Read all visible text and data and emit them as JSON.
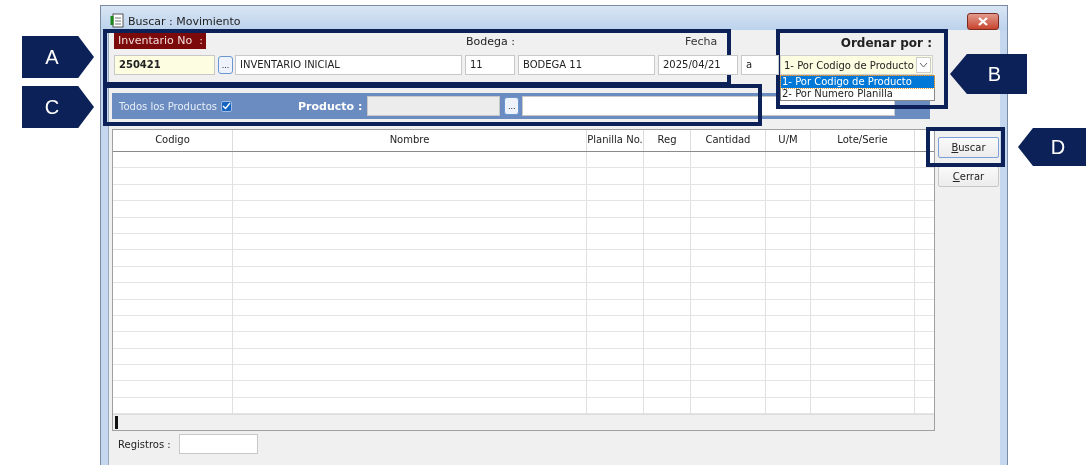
{
  "window": {
    "title": "Buscar : Movimiento"
  },
  "header": {
    "inventario_label": "Inventario No  :",
    "inventario_value": "250421",
    "lookup_button": "...",
    "descripcion": "INVENTARIO INICIAL",
    "bodega_label": "Bodega :",
    "bodega_code": "11",
    "bodega_name": "BODEGA 11",
    "fecha_label": "Fecha",
    "fecha_desde": "2025/04/21",
    "fecha_hasta": "a"
  },
  "ordenar": {
    "label": "Ordenar por :",
    "value": "1- Por Codigo de Producto",
    "expanded": true,
    "options": [
      {
        "label": "1- Por Codigo de Producto",
        "selected": true
      },
      {
        "label": "2- Por  Numero  Planilla",
        "selected": false
      }
    ]
  },
  "filter": {
    "todos_label": "Todos los Productos",
    "todos_checked": true,
    "producto_label": "Producto :",
    "lookup_button": "..."
  },
  "table": {
    "columns": [
      "Codigo",
      "Nombre",
      "Planilla No.",
      "Reg",
      "Cantidad",
      "U/M",
      "Lote/Serie"
    ]
  },
  "buttons": [
    {
      "label": "Buscar",
      "focused": true
    },
    {
      "label": "Cerrar",
      "focused": false
    }
  ],
  "footer": {
    "registros_label": "Registros :"
  },
  "callouts": [
    {
      "label": "A"
    },
    {
      "label": "B"
    },
    {
      "label": "C"
    },
    {
      "label": "D"
    }
  ]
}
